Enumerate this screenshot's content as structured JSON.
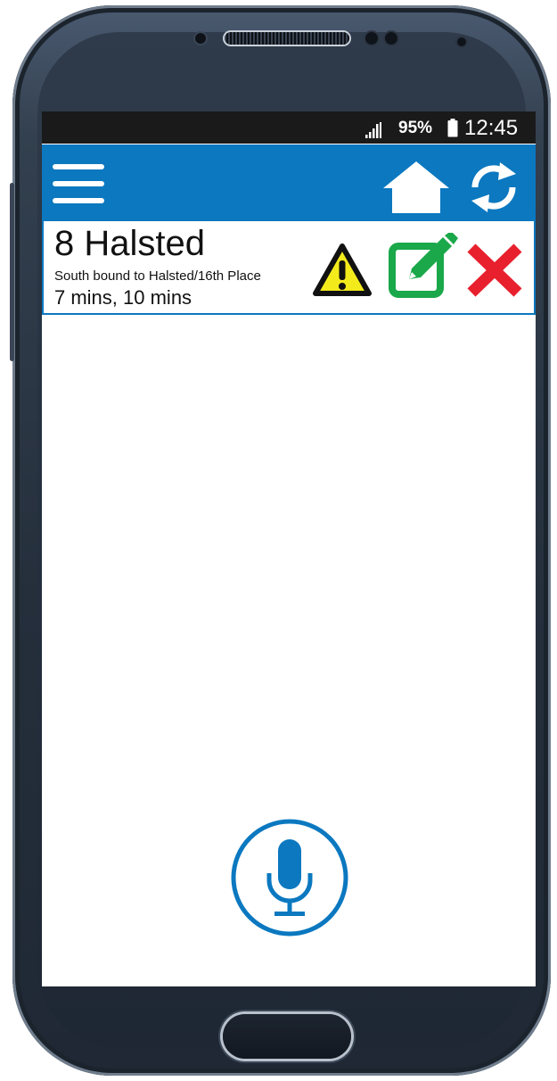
{
  "status_bar": {
    "battery_percent": "95%",
    "time": "12:45"
  },
  "app_bar": {
    "icons": [
      "menu-icon",
      "home-icon",
      "refresh-icon"
    ],
    "background_color": "#0b78c0"
  },
  "route_card": {
    "title": "8 Halsted",
    "direction": "South bound to Halsted/16th Place",
    "arrival_times": "7 mins, 10 mins",
    "icons": [
      "alert-icon",
      "edit-icon",
      "delete-icon"
    ]
  },
  "voice": {
    "icon": "microphone-icon"
  },
  "colors": {
    "accent_blue": "#0b78c0",
    "alert_yellow": "#f3ea1c",
    "edit_green": "#1aa84a",
    "delete_red": "#e8202e"
  }
}
